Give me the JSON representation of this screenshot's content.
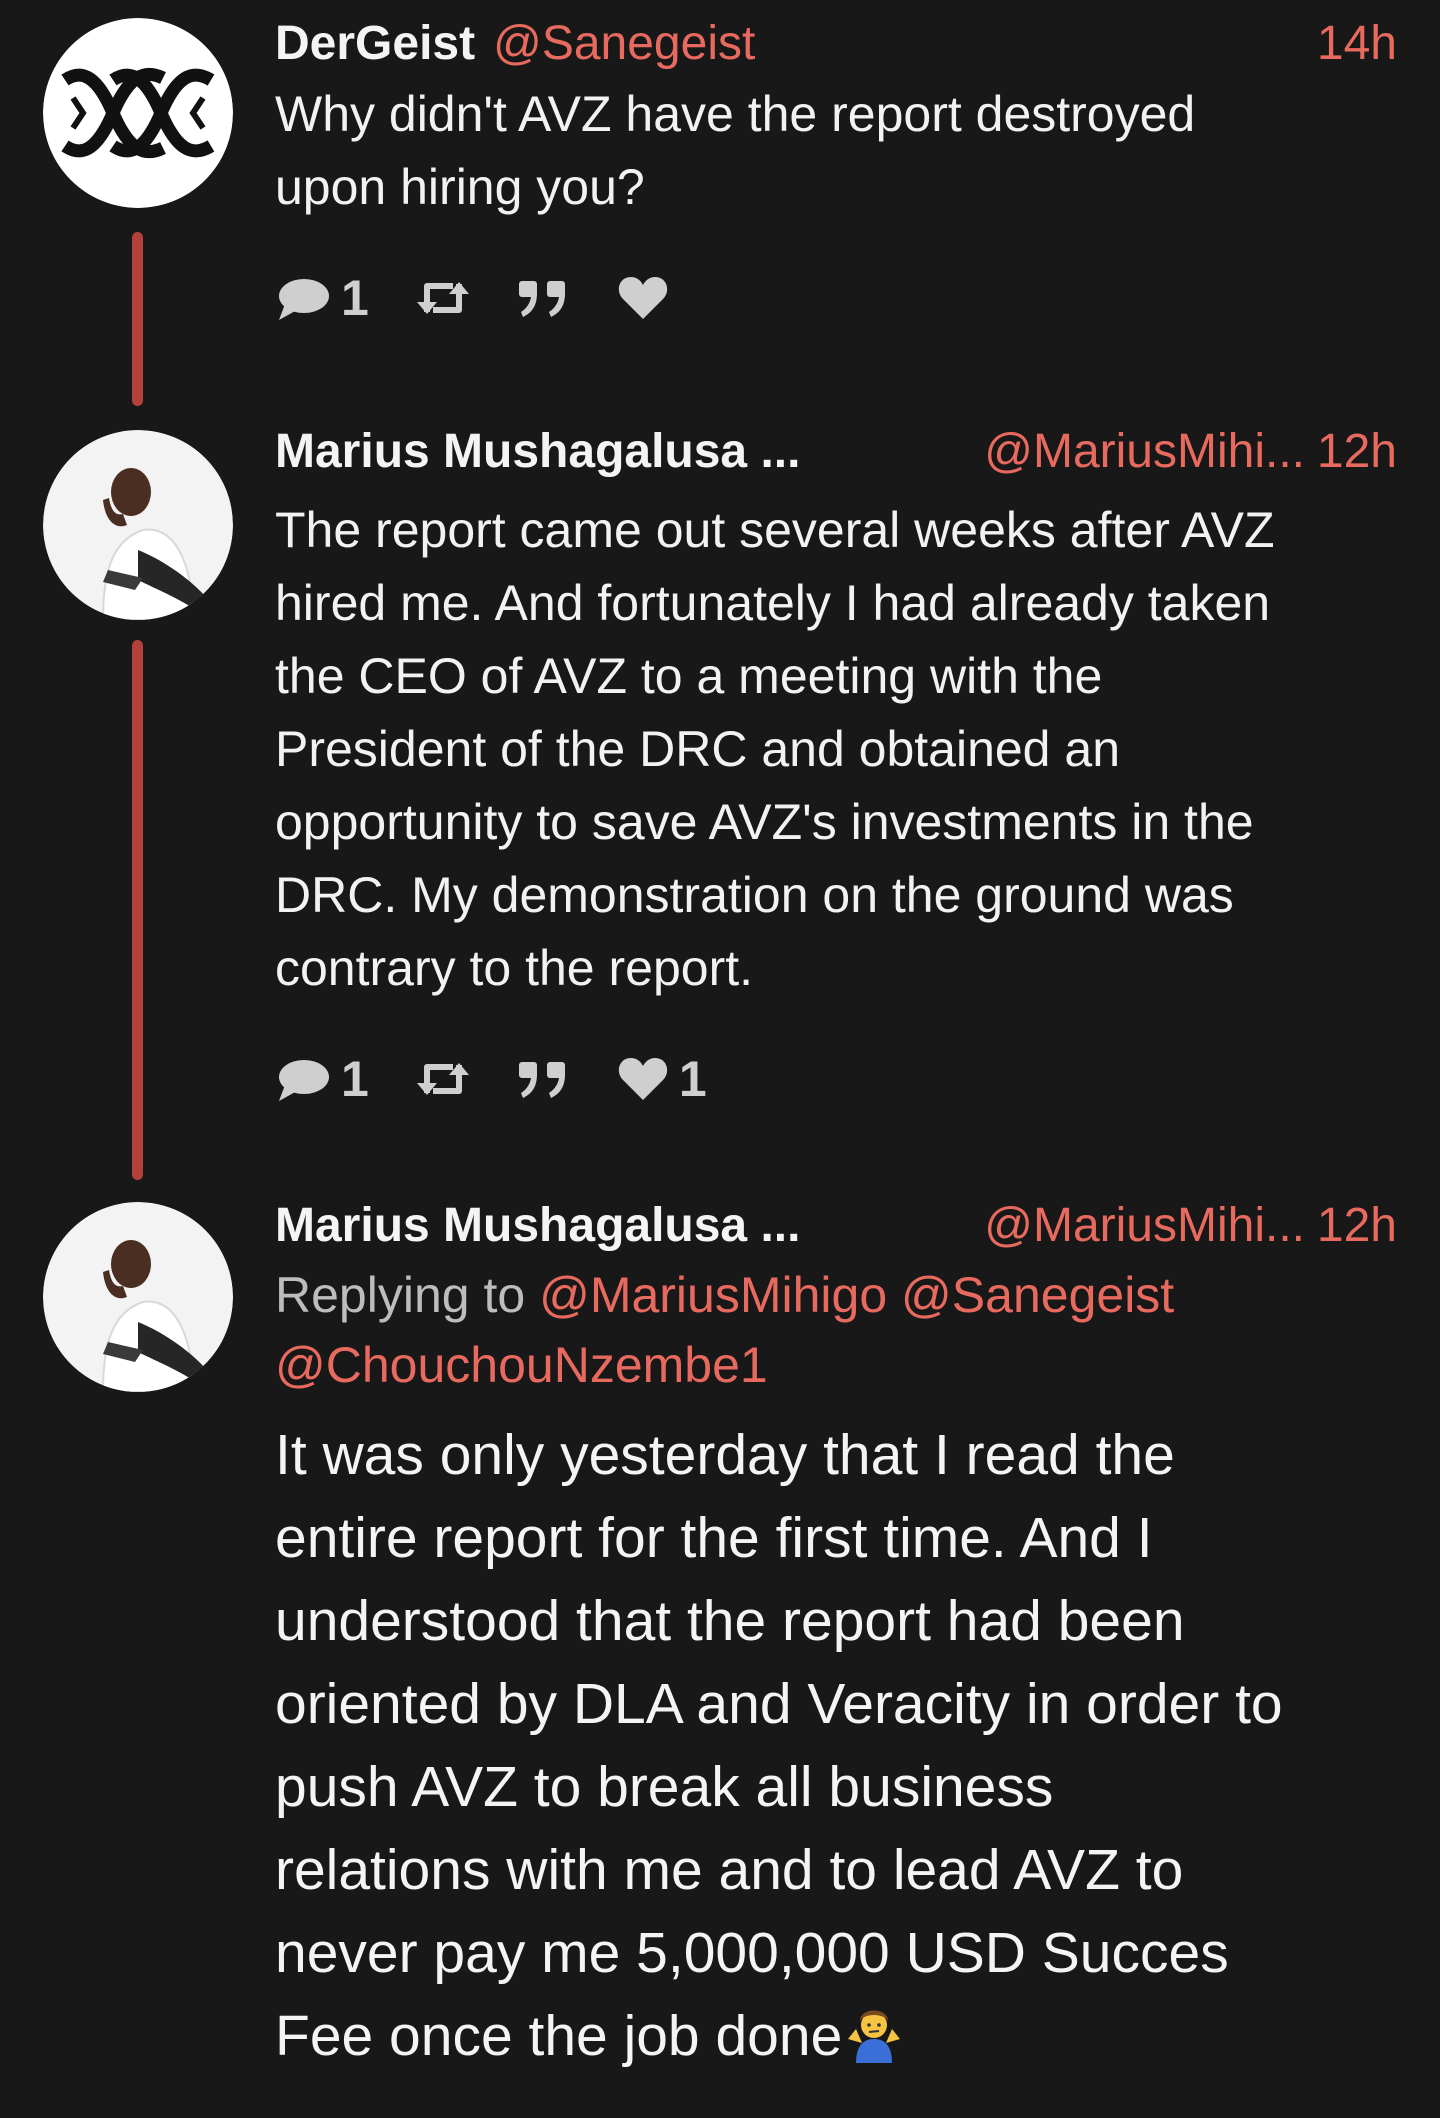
{
  "tweets": [
    {
      "name": "DerGeist",
      "handle": "@Sanegeist",
      "time": "14h",
      "text_lines": [
        "Why didn't AVZ have the report destroyed",
        "upon hiring you?"
      ],
      "reply_count": "1",
      "like_count": ""
    },
    {
      "name": "Marius Mushagalusa ...",
      "handle": "@MariusMihi...",
      "time": "12h",
      "text_lines": [
        "The report came out several weeks after AVZ",
        "hired me. And fortunately I had already taken",
        "the CEO of AVZ to a meeting with the",
        "President of the DRC and obtained an",
        "opportunity to save AVZ's investments in the",
        "DRC. My demonstration on the ground was",
        "contrary to the report."
      ],
      "reply_count": "1",
      "like_count": "1"
    },
    {
      "name": "Marius Mushagalusa ...",
      "handle": "@MariusMihi...",
      "time": "12h",
      "replying_prefix": "Replying to",
      "replying_mentions": [
        "@MariusMihigo",
        "@Sanegeist",
        "@ChouchouNzembe1"
      ],
      "text_lines": [
        "It was only yesterday that I read the",
        "entire report for the first time. And I",
        "understood that the report had been",
        "oriented by DLA and Veracity in order to",
        "push AVZ to break all business",
        "relations with me and to lead AVZ to",
        "never pay me 5,000,000 USD Succes",
        "Fee once the job done"
      ],
      "end_emoji": "person-shrugging"
    }
  ],
  "colors": {
    "background": "#181818",
    "accent": "#e86a5f",
    "thread_line": "#b2413c",
    "text": "#f2f2f2",
    "icon": "#cfcfcf"
  },
  "icons": [
    "reply-icon",
    "retweet-icon",
    "quote-icon",
    "like-icon"
  ]
}
